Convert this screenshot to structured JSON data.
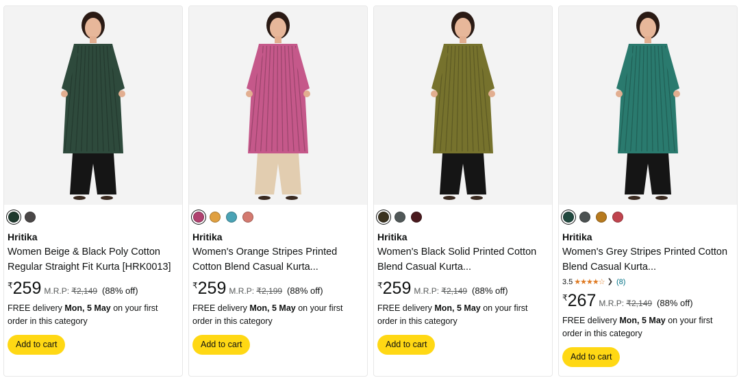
{
  "products": [
    {
      "dress_color": "#2e4a3c",
      "bottom_color": "#151515",
      "swatches": [
        "#1f3a2e",
        "#4a4747"
      ],
      "brand": "Hritika",
      "title_line1": "Women Beige & Black Poly Cotton",
      "title_line2": "Regular Straight Fit Kurta [HRK0013]",
      "rating": null,
      "rupee": "₹",
      "price": "259",
      "mrp_label": "M.R.P:",
      "mrp": "₹2,149",
      "off": "(88% off)",
      "delivery_prefix": "FREE delivery ",
      "delivery_date": "Mon, 5 May",
      "delivery_suffix": " on your first order in this category",
      "cart_label": "Add to cart"
    },
    {
      "dress_color": "#c5588a",
      "bottom_color": "#e2cdb0",
      "swatches": [
        "#b0416f",
        "#e0a040",
        "#4aa3b5",
        "#d47a70"
      ],
      "brand": "Hritika",
      "title_line1": "Women's Orange Stripes Printed",
      "title_line2": "Cotton Blend Casual Kurta...",
      "rating": null,
      "rupee": "₹",
      "price": "259",
      "mrp_label": "M.R.P:",
      "mrp": "₹2,199",
      "off": "(88% off)",
      "delivery_prefix": "FREE delivery ",
      "delivery_date": "Mon, 5 May",
      "delivery_suffix": " on your first order in this category",
      "cart_label": "Add to cart"
    },
    {
      "dress_color": "#76722d",
      "bottom_color": "#151515",
      "swatches": [
        "#3b3320",
        "#515858",
        "#4a1a1e"
      ],
      "brand": "Hritika",
      "title_line1": "Women's Black Solid Printed Cotton",
      "title_line2": "Blend Casual Kurta...",
      "rating": null,
      "rupee": "₹",
      "price": "259",
      "mrp_label": "M.R.P:",
      "mrp": "₹2,149",
      "off": "(88% off)",
      "delivery_prefix": "FREE delivery ",
      "delivery_date": "Mon, 5 May",
      "delivery_suffix": " on your first order in this category",
      "cart_label": "Add to cart"
    },
    {
      "dress_color": "#2a7a6e",
      "bottom_color": "#151515",
      "swatches": [
        "#21493f",
        "#4c5252",
        "#b77a1e",
        "#c0444e"
      ],
      "brand": "Hritika",
      "title_line1": "Women's Grey Stripes Printed Cotton",
      "title_line2": "Blend Casual Kurta...",
      "rating": {
        "value": "3.5",
        "stars": "★★★★☆",
        "count": "(8)"
      },
      "rupee": "₹",
      "price": "267",
      "mrp_label": "M.R.P:",
      "mrp": "₹2,149",
      "off": "(88% off)",
      "delivery_prefix": "FREE delivery ",
      "delivery_date": "Mon, 5 May",
      "delivery_suffix": " on your first order in this category",
      "cart_label": "Add to cart"
    }
  ]
}
